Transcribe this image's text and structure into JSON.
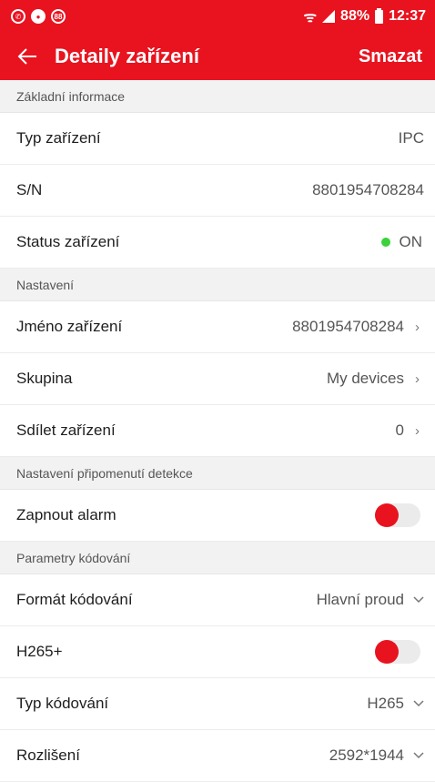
{
  "status_bar": {
    "icons_left": [
      "whatsapp-icon",
      "messenger-icon",
      "notification-88-icon"
    ],
    "notif_count": "88",
    "battery": "88%",
    "time": "12:37"
  },
  "header": {
    "title": "Detaily zařízení",
    "action": "Smazat"
  },
  "sections": {
    "basic": "Základní informace",
    "settings": "Nastavení",
    "detection": "Nastavení připomenutí detekce",
    "encoding": "Parametry kódování"
  },
  "rows": {
    "device_type": {
      "label": "Typ zařízení",
      "value": "IPC"
    },
    "sn": {
      "label": "S/N",
      "value": "8801954708284"
    },
    "status": {
      "label": "Status zařízení",
      "value": "ON"
    },
    "device_name": {
      "label": "Jméno zařízení",
      "value": "8801954708284"
    },
    "group": {
      "label": "Skupina",
      "value": "My devices"
    },
    "share": {
      "label": "Sdílet zařízení",
      "value": "0"
    },
    "alarm": {
      "label": "Zapnout alarm",
      "toggle": "off"
    },
    "encoding_format": {
      "label": "Formát kódování",
      "value": "Hlavní proud"
    },
    "h265plus": {
      "label": "H265+",
      "toggle": "off"
    },
    "encoding_type": {
      "label": "Typ kódování",
      "value": "H265"
    },
    "resolution": {
      "label": "Rozlišení",
      "value": "2592*1944"
    }
  },
  "colors": {
    "accent": "#e8131f",
    "status_on": "#3bd23b"
  }
}
